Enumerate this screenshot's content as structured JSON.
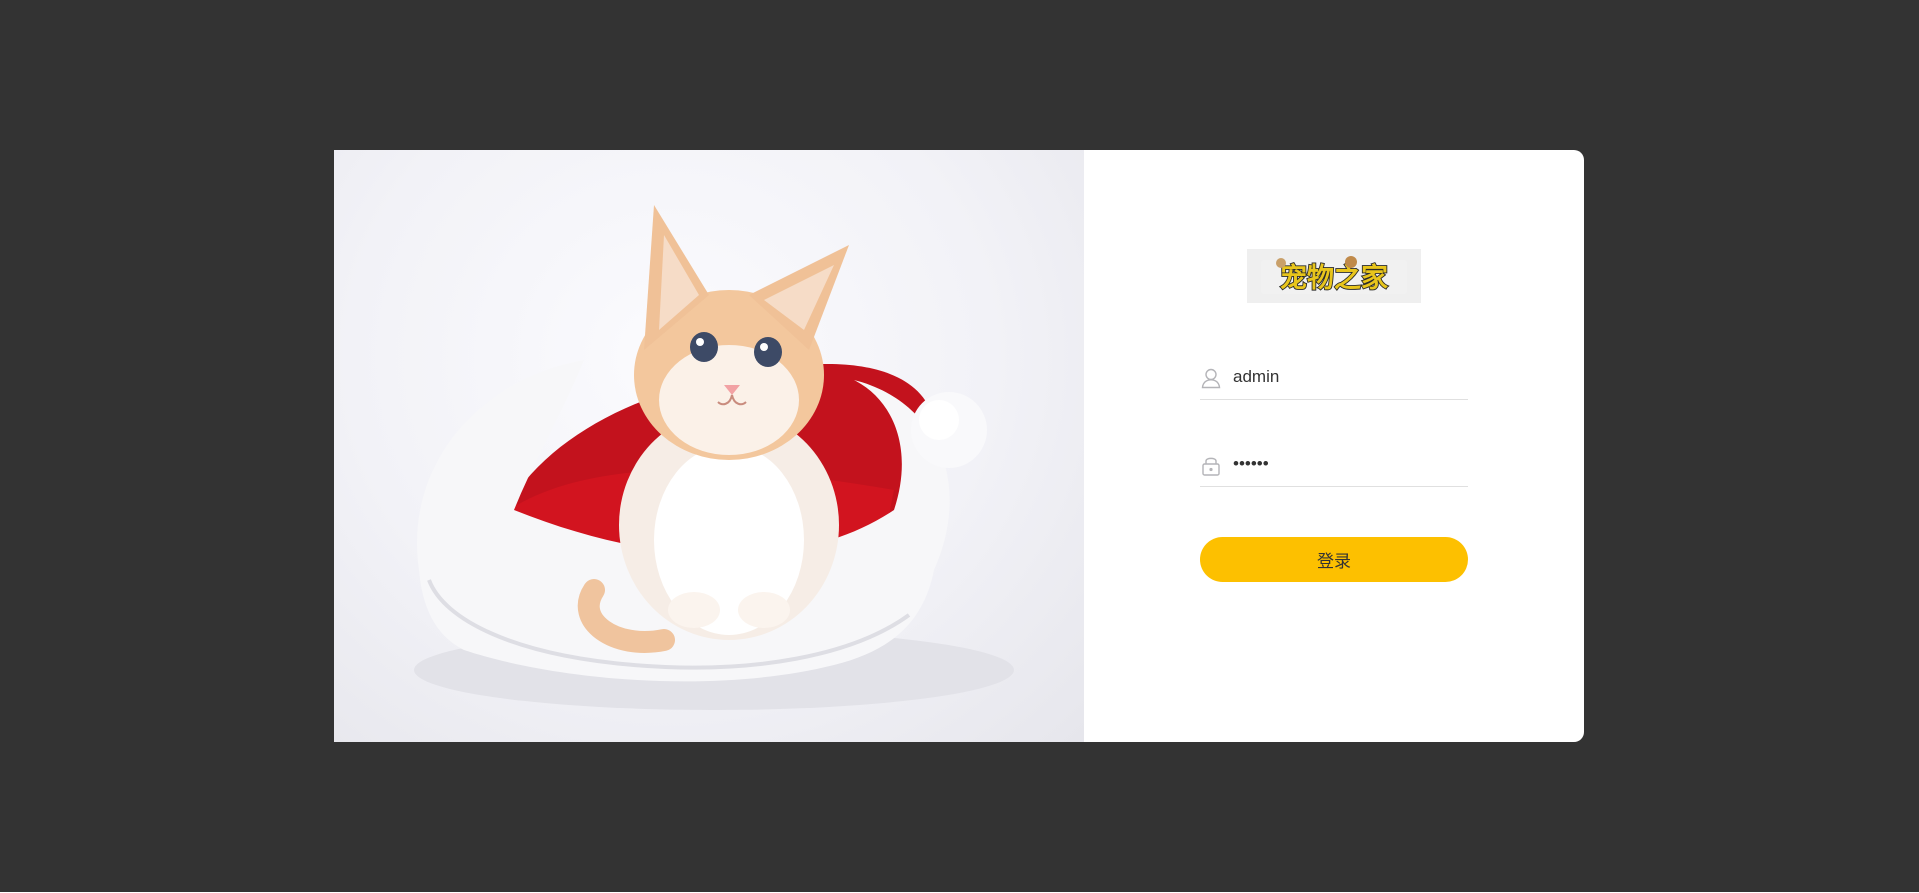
{
  "login": {
    "hero_image": "kitten-in-santa-hat-photo",
    "logo_text": "宠物之家",
    "username": {
      "value": "admin",
      "icon": "user-icon"
    },
    "password": {
      "value": "111111",
      "icon": "lock-icon"
    },
    "submit_label": "登录"
  },
  "colors": {
    "page_background": "#333333",
    "card_background": "#ffffff",
    "button_background": "#fdc000",
    "icon_color": "#b4b4b8"
  }
}
